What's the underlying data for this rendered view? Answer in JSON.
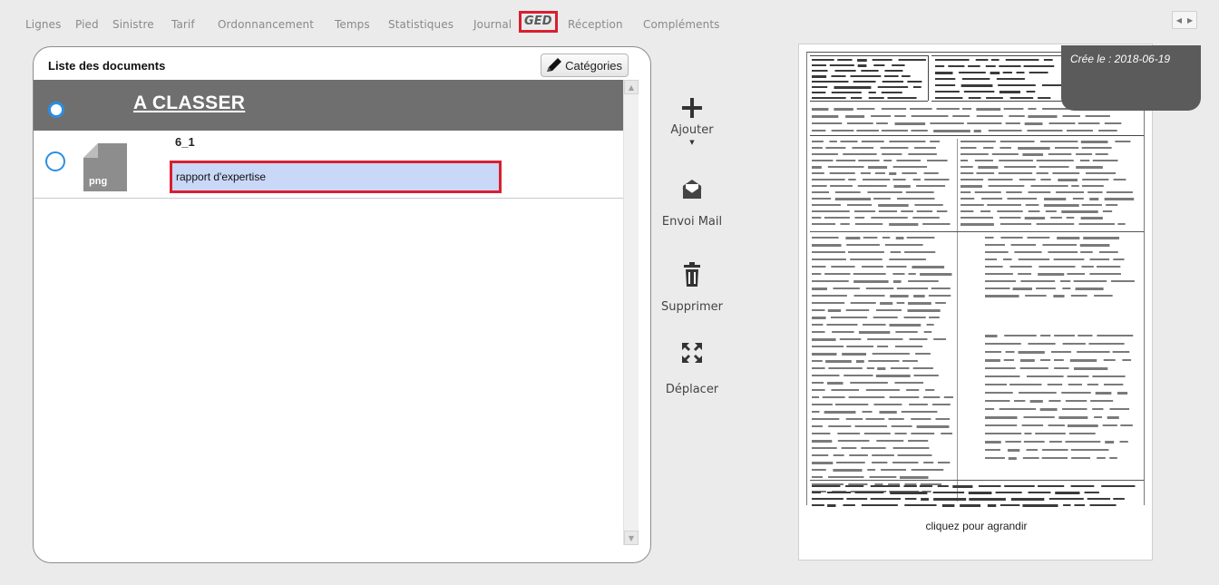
{
  "tabs": [
    {
      "label": "Lignes",
      "active": false
    },
    {
      "label": "Pied",
      "active": false
    },
    {
      "label": "Sinistre",
      "active": false
    },
    {
      "label": "Tarif",
      "active": false
    },
    {
      "label": "Ordonnancement",
      "active": false
    },
    {
      "label": "Temps",
      "active": false
    },
    {
      "label": "Statistiques",
      "active": false
    },
    {
      "label": "Journal",
      "active": false
    },
    {
      "label": "GED",
      "active": true
    },
    {
      "label": "Réception",
      "active": false
    },
    {
      "label": "Compléments",
      "active": false
    }
  ],
  "panel": {
    "title": "Liste des documents",
    "categories_label": "Catégories",
    "group_title": "A CLASSER",
    "document": {
      "name": "6_1",
      "ext": "png",
      "description": "rapport d'expertise"
    }
  },
  "actions": {
    "add": "Ajouter",
    "mail": "Envoi Mail",
    "delete": "Supprimer",
    "move": "Déplacer"
  },
  "preview": {
    "date": "Crée le : 2018-06-19",
    "caption": "cliquez pour agrandir"
  },
  "colors": {
    "accent_red": "#d8202f",
    "radio_blue": "#2b8ee3",
    "group_bar": "#6f6f6f",
    "input_bg": "#c9d8f7"
  }
}
